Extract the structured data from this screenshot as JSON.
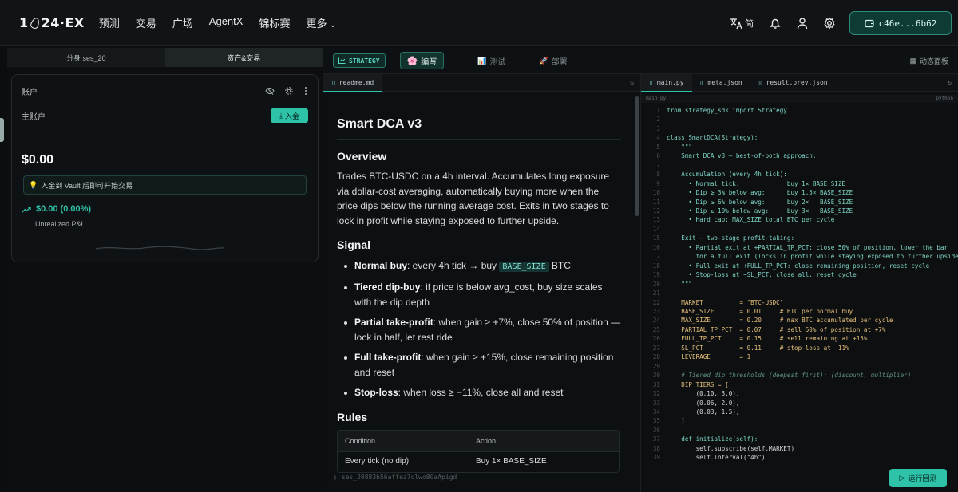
{
  "brand": {
    "logo_left": "1",
    "logo_right": "24·EX"
  },
  "nav": {
    "items": [
      "预测",
      "交易",
      "广场",
      "AgentX",
      "锦标赛",
      "更多"
    ]
  },
  "topbar": {
    "lang": "简",
    "wallet": "c46e...6b62"
  },
  "left_tabs": [
    "分身 ses_20",
    "资产&交易"
  ],
  "account": {
    "title": "账户",
    "main_label": "主账户",
    "deposit_label": "入金",
    "balance": "$0.00",
    "hint": "入金到 Vault 后即可开始交易",
    "pnl": "$0.00 (0.00%)",
    "pnl_label": "Unrealized P&L"
  },
  "toolbar": {
    "badge": "STRATEGY",
    "steps": [
      "编写",
      "测试",
      "部署"
    ],
    "dashboard": "动态面板"
  },
  "readme": {
    "tab": "readme.md",
    "title": "Smart DCA v3",
    "overview_h": "Overview",
    "overview_p": "Trades BTC-USDC on a 4h interval. Accumulates long exposure via dollar-cost averaging, automatically buying more when the price dips below the running average cost. Exits in two stages to lock in profit while staying exposed to further upside.",
    "signal_h": "Signal",
    "signals": [
      {
        "label": "Normal buy",
        "pre": ": every 4h tick → buy ",
        "code": "BASE_SIZE",
        "post": " BTC"
      },
      {
        "label": "Tiered dip-buy",
        "pre": ": if price is below avg_cost, buy size scales with the dip depth",
        "code": "",
        "post": ""
      },
      {
        "label": "Partial take-profit",
        "pre": ": when gain ≥ +7%, close 50% of position — lock in half, let rest ride",
        "code": "",
        "post": ""
      },
      {
        "label": "Full take-profit",
        "pre": ": when gain ≥ +15%, close remaining position and reset",
        "code": "",
        "post": ""
      },
      {
        "label": "Stop-loss",
        "pre": ": when loss ≥ −11%, close all and reset",
        "code": "",
        "post": ""
      }
    ],
    "rules_h": "Rules",
    "rules_cols": [
      "Condition",
      "Action"
    ],
    "rules_rows": [
      [
        "Every tick (no dip)",
        "Buy 1× BASE_SIZE"
      ]
    ],
    "session": "ses_20883b56affez7clwo80aApigd"
  },
  "code_tabs": [
    "main.py",
    "meta.json",
    "result.prev.json"
  ],
  "code_path": {
    "file": "main.py",
    "lang": "python"
  },
  "run_label": "运行回测",
  "code_lines": [
    "from strategy_sdk import Strategy",
    "",
    "",
    "class SmartDCA(Strategy):",
    "    \"\"\"",
    "    Smart DCA v3 — best-of-both approach:",
    "",
    "    Accumulation (every 4h tick):",
    "      • Normal tick:             buy 1× BASE_SIZE",
    "      • Dip ≥ 3% below avg:      buy 1.5× BASE_SIZE",
    "      • Dip ≥ 6% below avg:      buy 2×   BASE_SIZE",
    "      • Dip ≥ 10% below avg:     buy 3×   BASE_SIZE",
    "      • Hard cap: MAX_SIZE total BTC per cycle",
    "",
    "    Exit — two-stage profit-taking:",
    "      • Partial exit at +PARTIAL_TP_PCT: close 50% of position, lower the bar",
    "        for a full exit (locks in profit while staying exposed to further upside)",
    "      • Full exit at +FULL_TP_PCT: close remaining position, reset cycle",
    "      • Stop-loss at −SL_PCT: close all, reset cycle",
    "    \"\"\"",
    "",
    "    MARKET          = \"BTC-USDC\"",
    "    BASE_SIZE       = 0.01     # BTC per normal buy",
    "    MAX_SIZE        = 0.20     # max BTC accumulated per cycle",
    "    PARTIAL_TP_PCT  = 0.07     # sell 50% of position at +7%",
    "    FULL_TP_PCT     = 0.15     # sell remaining at +15%",
    "    SL_PCT          = 0.11     # stop-loss at −11%",
    "    LEVERAGE        = 1",
    "",
    "    # Tiered dip thresholds (deepest first): (discount, multiplier)",
    "    DIP_TIERS = [",
    "        (0.10, 3.0),",
    "        (0.06, 2.0),",
    "        (0.03, 1.5),",
    "    ]",
    "",
    "    def initialize(self):",
    "        self.subscribe(self.MARKET)",
    "        self.interval(\"4h\")"
  ]
}
